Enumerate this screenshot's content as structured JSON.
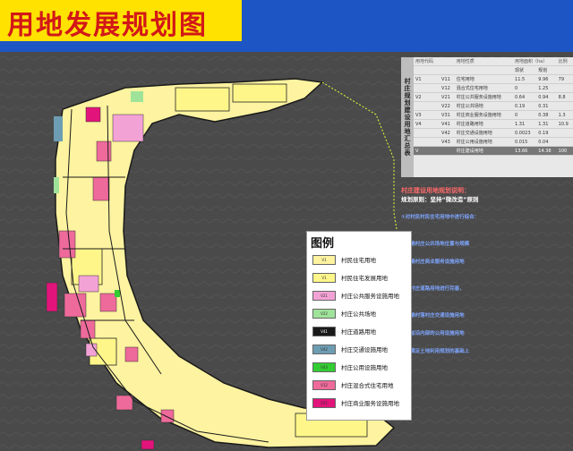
{
  "title": "用地发展规划图",
  "legend": {
    "title": "图例",
    "items": [
      {
        "code": "V1",
        "label": "村民住宅用地",
        "color": "#fdf3a0"
      },
      {
        "code": "V1",
        "label": "村民住宅发展用地",
        "color": "#fff68a"
      },
      {
        "code": "V21",
        "label": "村庄公共服务设施用地",
        "color": "#f3a2d6"
      },
      {
        "code": "V22",
        "label": "村庄公共场地",
        "color": "#9fe39a"
      },
      {
        "code": "V41",
        "label": "村庄道路用地",
        "color": "#1a1a1a"
      },
      {
        "code": "V42",
        "label": "村庄交通设施用地",
        "color": "#6d9db3"
      },
      {
        "code": "V43",
        "label": "村庄公用设施用地",
        "color": "#33cc33"
      },
      {
        "code": "V12",
        "label": "村庄混合式住宅用地",
        "color": "#ee6a9a"
      },
      {
        "code": "V31",
        "label": "村庄商业服务设施用地",
        "color": "#e2147b"
      }
    ]
  },
  "summary": {
    "heading": "村庄规划建设用地汇总表",
    "headers": [
      "用地代码",
      "",
      "用地性质",
      "用地面积（ha）",
      "",
      "比例"
    ],
    "subheaders": [
      "现状",
      "规划"
    ],
    "rows": [
      [
        "V1",
        "V11",
        "住宅用地",
        "11.5",
        "9.96",
        "79"
      ],
      [
        "",
        "V12",
        "混合式住宅用地",
        "0",
        "1.25",
        ""
      ],
      [
        "V2",
        "V21",
        "村庄公共服务设施用地",
        "0.64",
        "0.94",
        "8.8"
      ],
      [
        "",
        "V22",
        "村庄公共场地",
        "0.19",
        "0.31",
        ""
      ],
      [
        "V3",
        "V31",
        "村庄商业服务设施用地",
        "0",
        "0.38",
        "1.3"
      ],
      [
        "V4",
        "V41",
        "村庄道路用地",
        "1.31",
        "1.31",
        "10.9"
      ],
      [
        "",
        "V42",
        "村庄交通设施用地",
        "0.0023",
        "0.19",
        ""
      ],
      [
        "",
        "V43",
        "村庄公用设施用地",
        "0.015",
        "0.04",
        ""
      ]
    ],
    "total": [
      "V",
      "",
      "村庄建设用地",
      "13.66",
      "14.38",
      "100"
    ]
  },
  "explain": {
    "heading": "村庄建设用地规划说明：",
    "principle": "规划原则：坚持“微改造”原则",
    "lines": [
      "①对村民村民住宅用地中进行综合：",
      "②明确村庄公共场地位置与规模",
      "③明确村庄商业服务设施用地",
      "④对村庄道路用地进行完善，",
      "⑤明确村落村庄交通设施用地",
      "⑥增加沿内部的公用设施用地",
      "⑦在满足土地利用规划的基础上"
    ]
  },
  "colors": {
    "background": "#1d55c4",
    "title_bg": "#ffe200",
    "title_text": "#d21818",
    "map_bg": "#4a4a4a"
  }
}
